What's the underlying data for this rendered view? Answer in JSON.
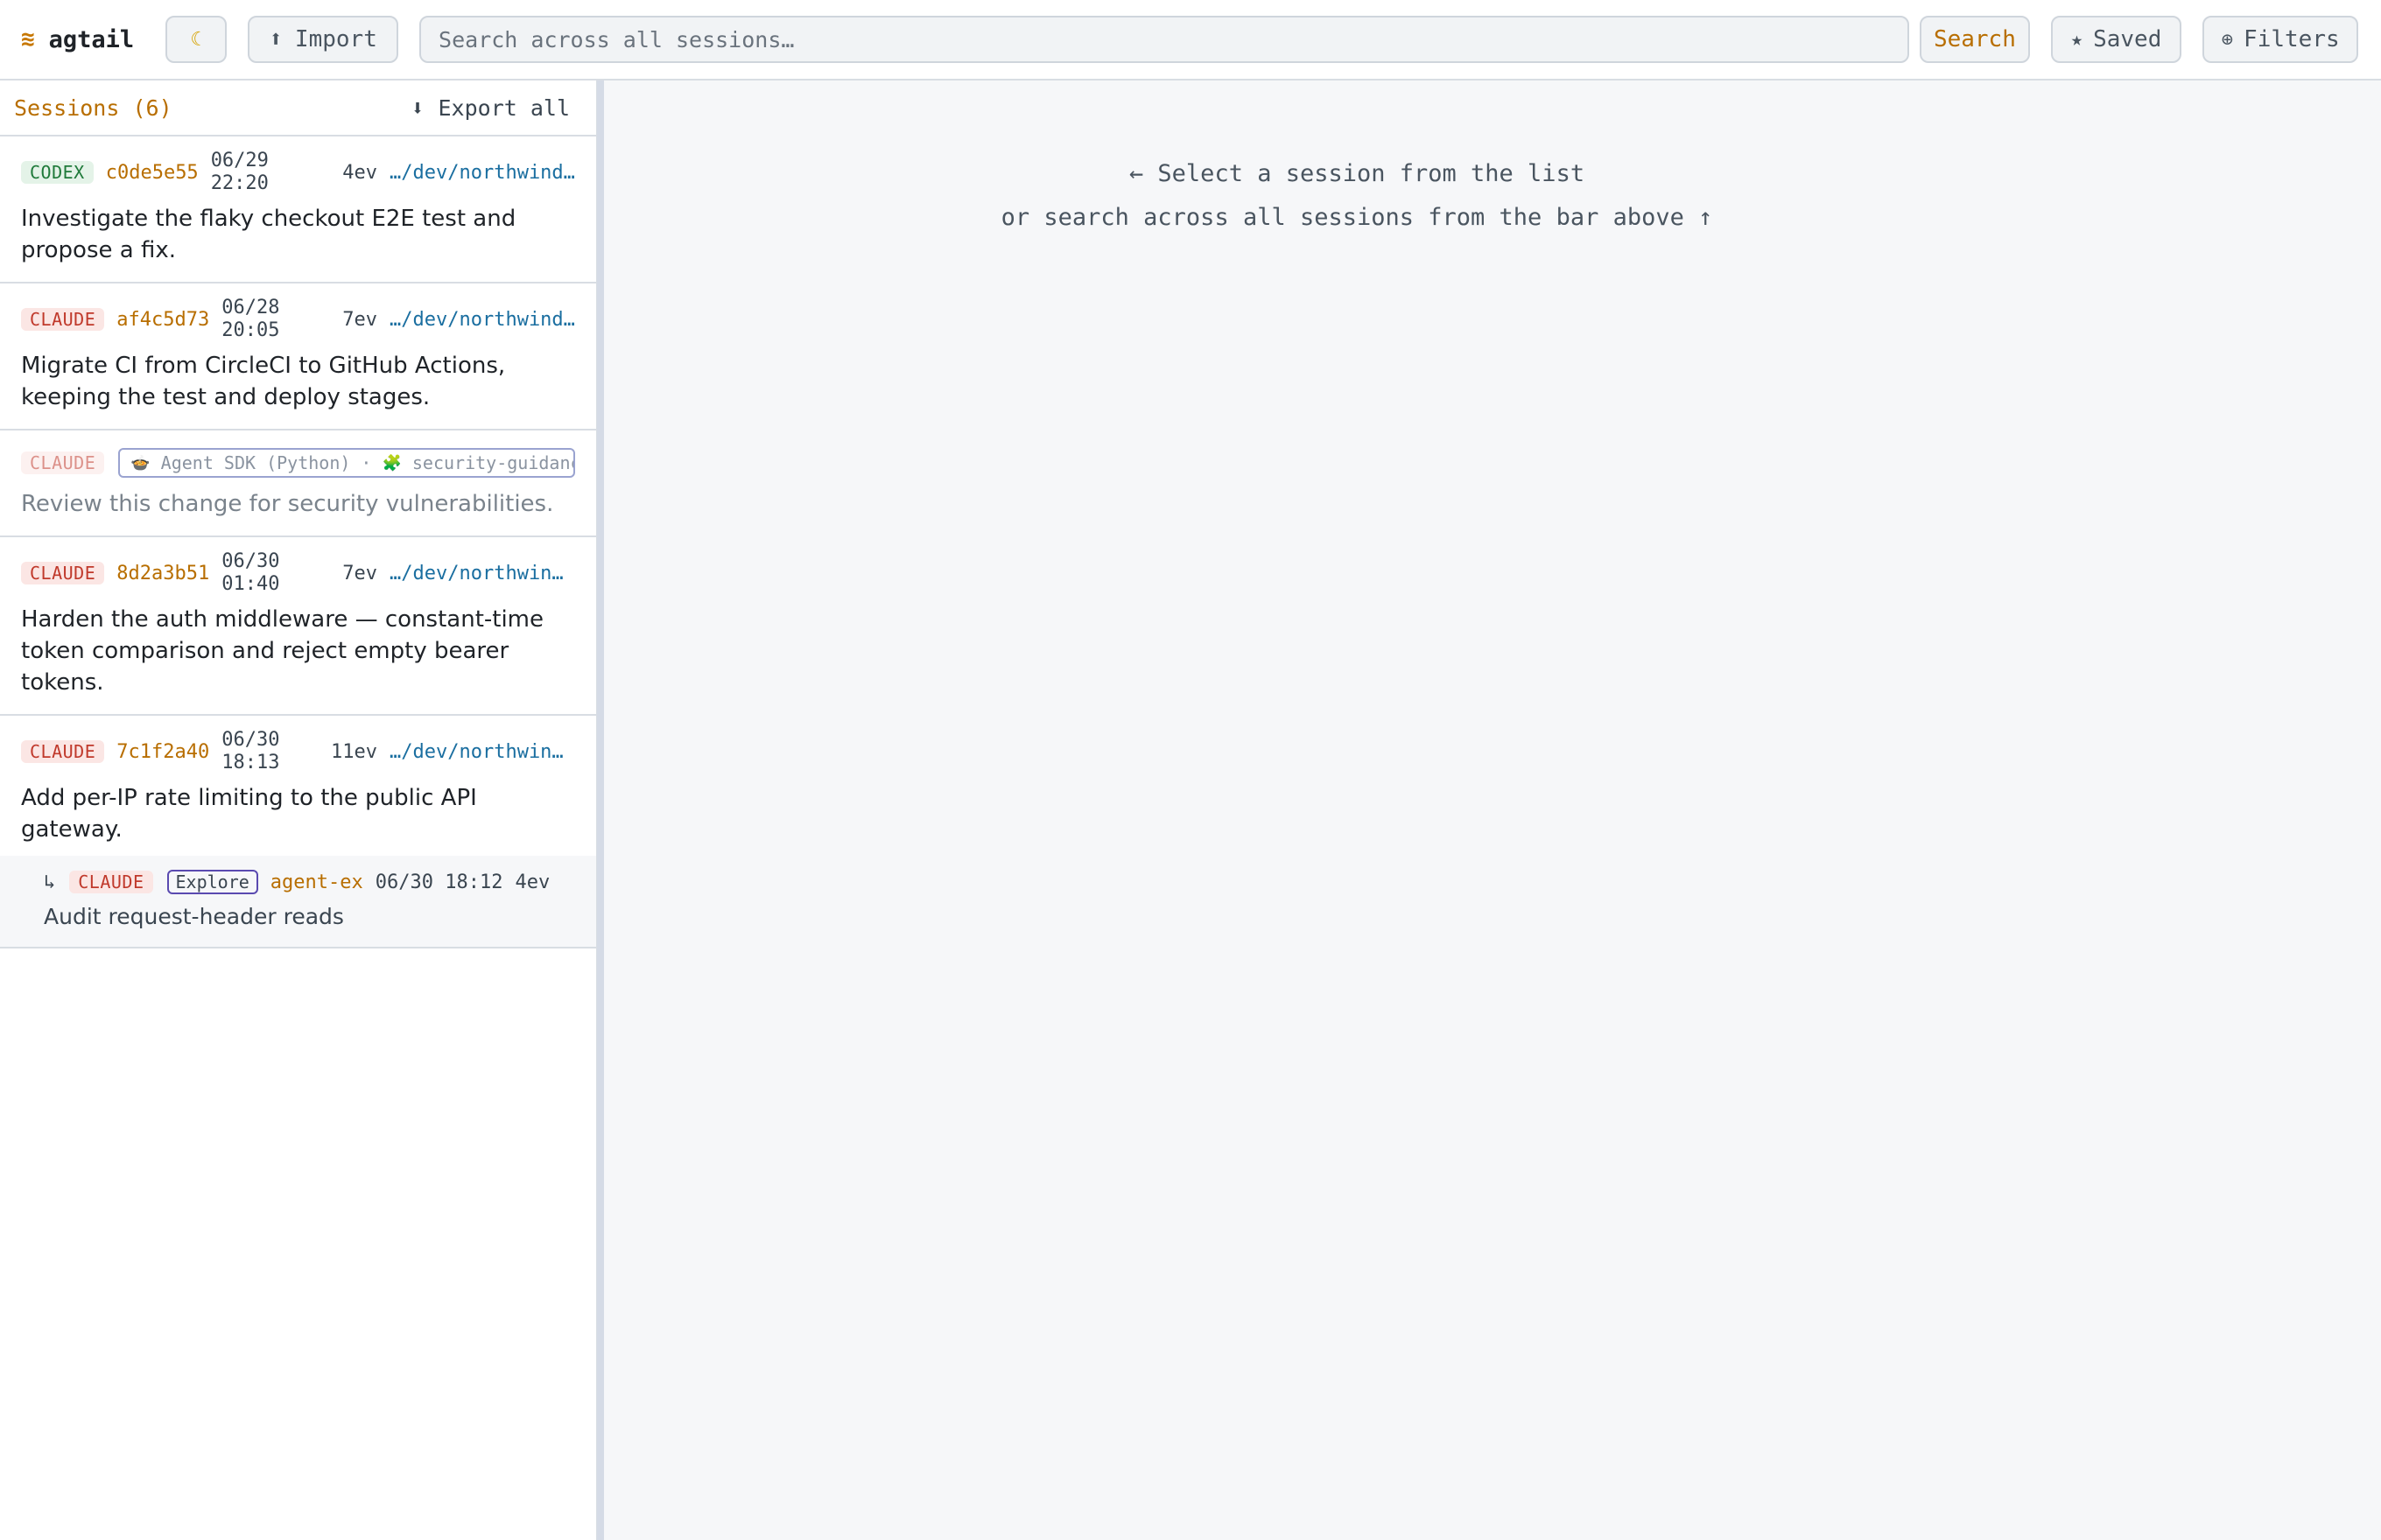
{
  "app": {
    "brand_icon": "≋",
    "name": "agtail",
    "theme_icon": "☾"
  },
  "toolbar": {
    "import_icon": "⬆",
    "import_label": "Import",
    "search_placeholder": "Search across all sessions…",
    "search_label": "Search",
    "saved_icon": "★",
    "saved_label": "Saved",
    "filters_icon": "⊕",
    "filters_label": "Filters"
  },
  "sidebar": {
    "count_label": "Sessions (6)",
    "export_icon": "⬇",
    "export_label": "Export all",
    "sessions": [
      {
        "agent": "CODEX",
        "id": "c0de5e55",
        "date": "06/29",
        "time": "22:20",
        "events": "4ev",
        "path": "…/dev/northwind…",
        "title": "Investigate the flaky checkout E2E test and propose a fix."
      },
      {
        "agent": "CLAUDE",
        "id": "af4c5d73",
        "date": "06/28",
        "time": "20:05",
        "events": "7ev",
        "path": "…/dev/northwind…",
        "title": "Migrate CI from CircleCI to GitHub Actions, keeping the test and deploy stages."
      },
      {
        "agent": "CLAUDE",
        "sdk_icon": "🍲",
        "sdk": "Agent SDK (Python)",
        "separator": "·",
        "plugin_icon": "🧩",
        "plugin": "security-guidance",
        "title": "Review this change for security vulnerabilities."
      },
      {
        "agent": "CLAUDE",
        "id": "8d2a3b51",
        "date": "06/30",
        "time": "01:40",
        "events": "7ev",
        "path": "…/dev/northwin…",
        "title": "Harden the auth middleware — constant-time token comparison and reject empty bearer tokens."
      },
      {
        "agent": "CLAUDE",
        "id": "7c1f2a40",
        "date": "06/30",
        "time": "18:13",
        "events": "11ev",
        "path": "…/dev/northwin…",
        "title": "Add per-IP rate limiting to the public API gateway.",
        "child": {
          "arrow": "↳",
          "agent": "CLAUDE",
          "kind": "Explore",
          "agent_name": "agent-ex",
          "datetime": "06/30 18:12",
          "events": "4ev",
          "title": "Audit request-header reads"
        }
      }
    ]
  },
  "main": {
    "empty_line1": "← Select a session from the list",
    "empty_line2": "or search across all sessions from the bar above ↑"
  },
  "colors": {
    "accent": "#b86e00",
    "codex_badge_bg": "#e4f3e8",
    "claude_badge_bg": "#fbe6e4",
    "path": "#1a6ea0"
  }
}
